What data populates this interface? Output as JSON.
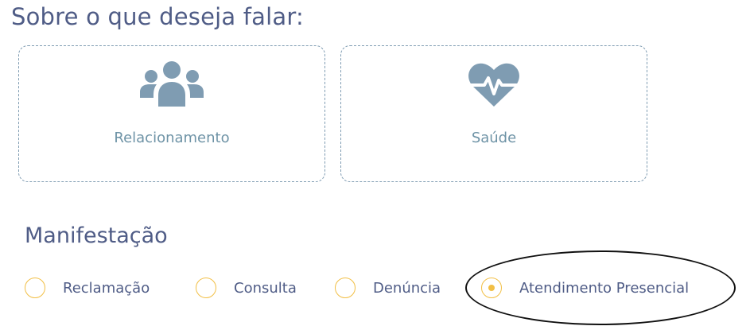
{
  "topic_heading": "Sobre o que deseja falar:",
  "topics": [
    {
      "label": "Relacionamento",
      "icon": "users-group-icon"
    },
    {
      "label": "Saúde",
      "icon": "heart-pulse-icon"
    }
  ],
  "manifestation": {
    "title": "Manifestação",
    "options": [
      {
        "label": "Reclamação",
        "selected": false
      },
      {
        "label": "Consulta",
        "selected": false
      },
      {
        "label": "Denúncia",
        "selected": false
      },
      {
        "label": "Atendimento Presencial",
        "selected": true
      }
    ],
    "highlighted_option": "Atendimento Presencial"
  },
  "colors": {
    "heading": "#4f5c86",
    "icon": "#7f9cb2",
    "card_label": "#6e93a6",
    "radio_accent": "#f2bf45"
  }
}
